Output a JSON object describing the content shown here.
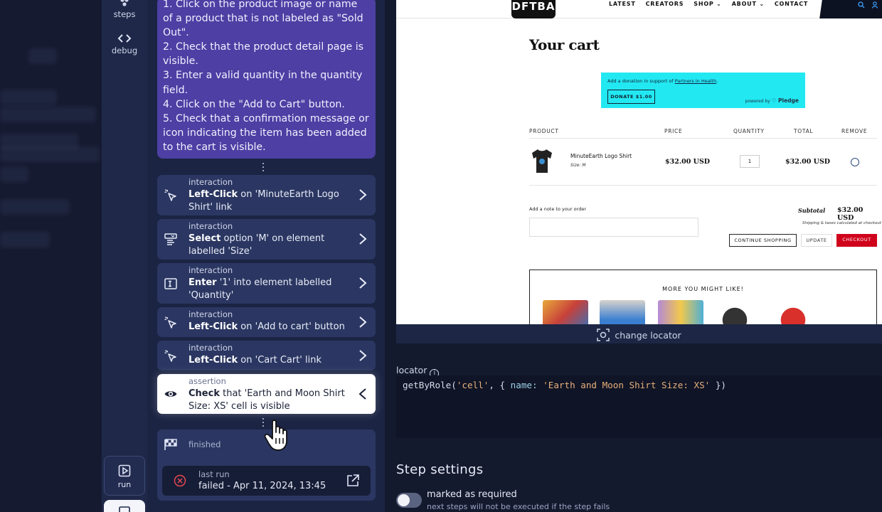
{
  "rail": {
    "steps_label": "steps",
    "debug_label": "debug",
    "run_label": "run"
  },
  "prompt": {
    "text": "1. Click on the product image or name of a product that is not labeled as \"Sold Out\".\n2. Check that the product detail page is visible.\n3. Enter a valid quantity in the quantity field.\n4. Click on the \"Add to Cart\" button.\n5. Check that a confirmation message or icon indicating the item has been added to the cart is visible."
  },
  "steps": [
    {
      "kind": "interaction",
      "action": "Left-Click",
      "rest": " on 'MinuteEarth Logo Shirt' link",
      "icon": "cursor-click-icon"
    },
    {
      "kind": "interaction",
      "action": "Select",
      "rest": " option 'M' on element labelled 'Size'",
      "icon": "select-option-icon"
    },
    {
      "kind": "interaction",
      "action": "Enter",
      "rest": " '1' into element labelled 'Quantity'",
      "icon": "text-input-icon"
    },
    {
      "kind": "interaction",
      "action": "Left-Click",
      "rest": " on 'Add to cart' button",
      "icon": "cursor-click-icon"
    },
    {
      "kind": "interaction",
      "action": "Left-Click",
      "rest": " on 'Cart Cart' link",
      "icon": "cursor-click-icon"
    },
    {
      "kind": "assertion",
      "action": "Check",
      "rest": " that 'Earth and Moon Shirt Size: XS' cell is visible",
      "icon": "eye-icon"
    }
  ],
  "finished": {
    "label": "finished",
    "last_run_label": "last run",
    "last_run_value": "failed - Apr 11, 2024, 13:45"
  },
  "site": {
    "logo_text": "DFTBA",
    "nav": [
      "LATEST",
      "CREATORS",
      "SHOP ⌄",
      "ABOUT ⌄",
      "CONTACT"
    ],
    "title": "Your cart",
    "donation_text": "Add a donation in support of ",
    "donation_link": "Partners in Health",
    "donation_text_end": ".",
    "donate_button": "DONATE $1.00",
    "powered_by": "powered by ",
    "pledge": "♡ Pledge",
    "headers": {
      "product": "PRODUCT",
      "price": "PRICE",
      "quantity": "QUANTITY",
      "total": "TOTAL",
      "remove": "REMOVE"
    },
    "item": {
      "name": "MinuteEarth Logo Shirt",
      "size": "Size: M",
      "price": "$32.00 USD",
      "qty": "1",
      "total": "$32.00 USD"
    },
    "note_label": "Add a note to your order",
    "subtotal_label": "Subtotal",
    "subtotal_value": "$32.00 USD",
    "shipping_note": "Shipping & taxes calculated at checkout",
    "continue_btn": "CONTINUE SHOPPING",
    "update_btn": "UPDATE",
    "checkout_btn": "CHECKOUT",
    "more_heading": "MORE YOU MIGHT LIKE!"
  },
  "change_locator": "change locator",
  "locator": {
    "label": "locator",
    "code_fn": "getByRole(",
    "code_arg1": "'cell'",
    "code_mid": ", { ",
    "code_key": "name:",
    "code_sp": " ",
    "code_arg2": "'Earth and Moon Shirt Size: XS'",
    "code_end": " })"
  },
  "settings": {
    "title": "Step settings",
    "required_label": "marked as required",
    "required_sub": "next steps will not be executed if the step fails"
  },
  "colors": {
    "prompt_bg": "#4d3fa3",
    "card_bg": "#2b3762",
    "checkout_red": "#d0021b",
    "donate_cyan": "#22e8f2",
    "failed_red": "#e5484d"
  }
}
